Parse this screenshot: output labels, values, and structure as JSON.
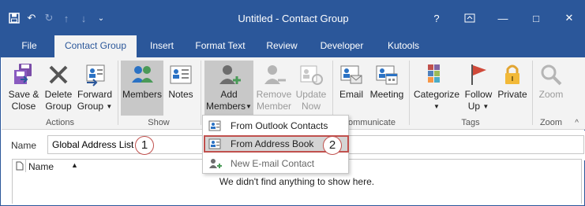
{
  "window": {
    "title": "Untitled - Contact Group",
    "help": "?",
    "restore": "⧉",
    "minimize": "—",
    "maximize": "□",
    "close": "✕"
  },
  "qat": {
    "save": "💾",
    "undo": "↶",
    "redo": "↻",
    "up": "↑",
    "down": "↓",
    "more": "⌄"
  },
  "tabs": [
    "File",
    "Contact Group",
    "Insert",
    "Format Text",
    "Review",
    "Developer",
    "Kutools"
  ],
  "ribbon": {
    "save_close": [
      "Save &",
      "Close"
    ],
    "delete_group": [
      "Delete",
      "Group"
    ],
    "forward_group": [
      "Forward",
      "Group"
    ],
    "actions_label": "Actions",
    "members": "Members",
    "notes": "Notes",
    "show_label": "Show",
    "add_members": [
      "Add",
      "Members"
    ],
    "remove_member": [
      "Remove",
      "Member"
    ],
    "update_now": [
      "Update",
      "Now"
    ],
    "email": "Email",
    "meeting": "Meeting",
    "communicate_label": "ommunicate",
    "categorize": "Categorize",
    "follow_up": [
      "Follow",
      "Up"
    ],
    "private": "Private",
    "tags_label": "Tags",
    "zoom": "Zoom",
    "zoom_label": "Zoom",
    "collapse": "^"
  },
  "form": {
    "name_label": "Name",
    "name_value": "Global Address List",
    "callout1": "1",
    "callout2": "2",
    "col_name": "Name",
    "sort_indicator": "▲",
    "empty_message": "We didn't find anything to show here."
  },
  "dropdown": {
    "items": [
      "From Outlook Contacts",
      "From Address Book",
      "New E-mail Contact"
    ]
  },
  "colors": {
    "accent": "#2b579a",
    "callout": "#c0504d"
  }
}
